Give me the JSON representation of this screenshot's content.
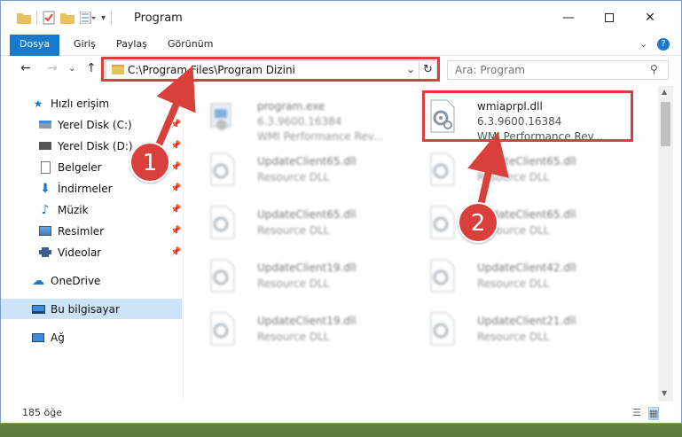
{
  "window": {
    "title": "Program"
  },
  "ribbon": {
    "tabs": [
      "Dosya",
      "Giriş",
      "Paylaş",
      "Görünüm"
    ]
  },
  "navbar": {
    "path": "C:\\Program Files\\Program Dizini",
    "search_placeholder": "Ara: Program"
  },
  "sidebar": {
    "items": [
      {
        "label": "Hızlı erişim",
        "icon": "star-icon",
        "pinned": false
      },
      {
        "label": "Yerel Disk (C:)",
        "icon": "drive-icon",
        "pinned": true
      },
      {
        "label": "Yerel Disk (D:)",
        "icon": "drive-icon",
        "pinned": true
      },
      {
        "label": "Belgeler",
        "icon": "documents-icon",
        "pinned": true
      },
      {
        "label": "İndirmeler",
        "icon": "download-icon",
        "pinned": true
      },
      {
        "label": "Müzik",
        "icon": "music-icon",
        "pinned": true
      },
      {
        "label": "Resimler",
        "icon": "pictures-icon",
        "pinned": true
      },
      {
        "label": "Videolar",
        "icon": "videos-icon",
        "pinned": true
      },
      {
        "label": "OneDrive",
        "icon": "cloud-icon",
        "pinned": false
      },
      {
        "label": "Bu bilgisayar",
        "icon": "computer-icon",
        "pinned": false,
        "selected": true
      },
      {
        "label": "Ağ",
        "icon": "network-icon",
        "pinned": false
      }
    ]
  },
  "files": [
    {
      "name": "program.exe",
      "line2": "6.3.9600.16384",
      "line3": "WMI Performance Rev...",
      "type": "exe"
    },
    {
      "name": "wmiaprpl.dll",
      "line2": "6.3.9600.16384",
      "line3": "WMI Performance Rev...",
      "type": "dll-highlight"
    },
    {
      "name": "UpdateClient65.dll",
      "line2": "Resource DLL",
      "type": "dll"
    },
    {
      "name": "UpdateClient65.dll",
      "line2": "Resource DLL",
      "type": "dll"
    },
    {
      "name": "UpdateClient65.dll",
      "line2": "Resource DLL",
      "type": "dll"
    },
    {
      "name": "UpdateClient65.dll",
      "line2": "Resource DLL",
      "type": "dll"
    },
    {
      "name": "UpdateClient19.dll",
      "line2": "Resource DLL",
      "type": "dll"
    },
    {
      "name": "UpdateClient42.dll",
      "line2": "Resource DLL",
      "type": "dll"
    },
    {
      "name": "UpdateClient19.dll",
      "line2": "Resource DLL",
      "type": "dll"
    },
    {
      "name": "UpdateClient21.dll",
      "line2": "Resource DLL",
      "type": "dll"
    }
  ],
  "status": {
    "count_text": "185 öğe"
  },
  "callouts": [
    "1",
    "2"
  ],
  "colors": {
    "accent": "#1979ca",
    "highlight": "#d9403b",
    "selected_bg": "#cde3f7"
  }
}
